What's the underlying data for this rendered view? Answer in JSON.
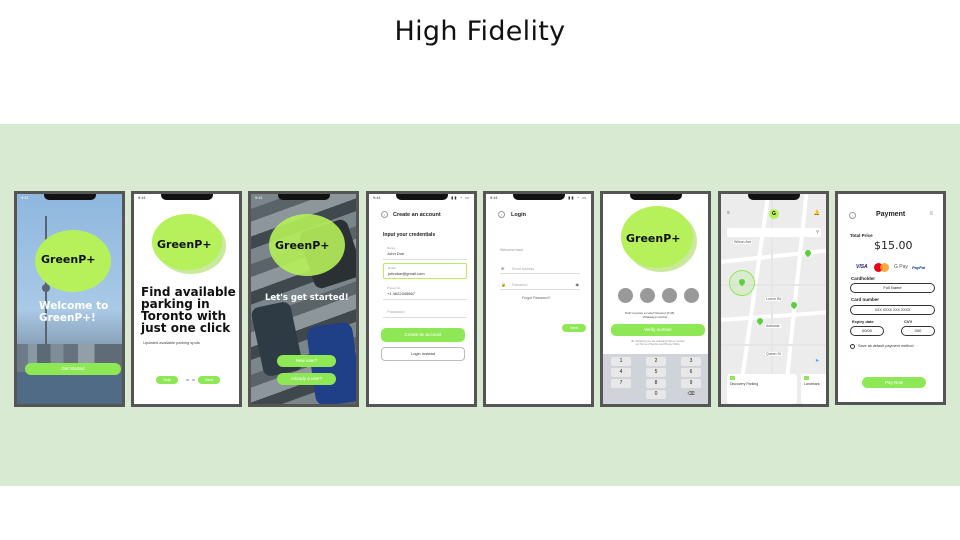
{
  "slide": {
    "title": "High Fidelity"
  },
  "colors": {
    "band": "#d9ead3",
    "accent": "#8ee855",
    "blob": "#b6f05a",
    "frame": "#555555"
  },
  "status": {
    "time": "9:41"
  },
  "s1": {
    "logo": "GreenP+",
    "welcome": "Welcome to GreenP+!",
    "cta": "Get Started"
  },
  "s2": {
    "logo": "GreenP+",
    "headline": "Find available parking in Toronto with just one click",
    "sub": "Updated available parking spots",
    "skip": "Skip",
    "next": "Next"
  },
  "s3": {
    "logo": "GreenP+",
    "title": "Let's get started!",
    "new_user": "New user?",
    "already": "Already a user?"
  },
  "s4": {
    "title": "Create an account",
    "section": "Input your credentials",
    "fields": [
      {
        "label": "Name",
        "value": "John Doe"
      },
      {
        "label": "Email",
        "value": "johndoe@gmail.com"
      },
      {
        "label": "Phone No.",
        "value": "+1 4622345667"
      },
      {
        "label": "",
        "value": "Password"
      }
    ],
    "create": "Create an account",
    "login": "Login Instead"
  },
  "s5": {
    "title": "Login",
    "sub": "Welcome back",
    "email": "Email address",
    "password": "Password",
    "forgot": "Forgot Password?",
    "next": "Next"
  },
  "s6": {
    "logo": "GreenP+",
    "resend": "Didn't receive a code? Resend (0:45)",
    "whats": "Whatsapp number",
    "verify": "Verify number",
    "note": "By continuing you are indicating that you accept our Terms of Service and Privacy Policy.",
    "keys": [
      "1",
      "2",
      "3",
      "4",
      "5",
      "6",
      "7",
      "8",
      "9",
      "0",
      "⌫"
    ]
  },
  "s7": {
    "labels": [
      "Wilson Ave",
      "Lorem Rd",
      "Adelaide",
      "Queen St"
    ],
    "card1": "Discovery Parking",
    "card2": "Landmark"
  },
  "s8": {
    "title": "Payment",
    "total_label": "Total Price",
    "total": "$15.00",
    "brands": [
      "VISA",
      "G Pay",
      "PayPal"
    ],
    "cardholder_label": "Cardholder",
    "cardholder": "Full Name",
    "cardnum_label": "Card number",
    "cardnum": "XXX  XXXX  XXX XXXX",
    "expiry_label": "Expiry date",
    "expiry": "00/00",
    "cvv_label": "CVV",
    "cvv": "000",
    "save": "Save as default payment method",
    "pay": "Pay Now"
  }
}
